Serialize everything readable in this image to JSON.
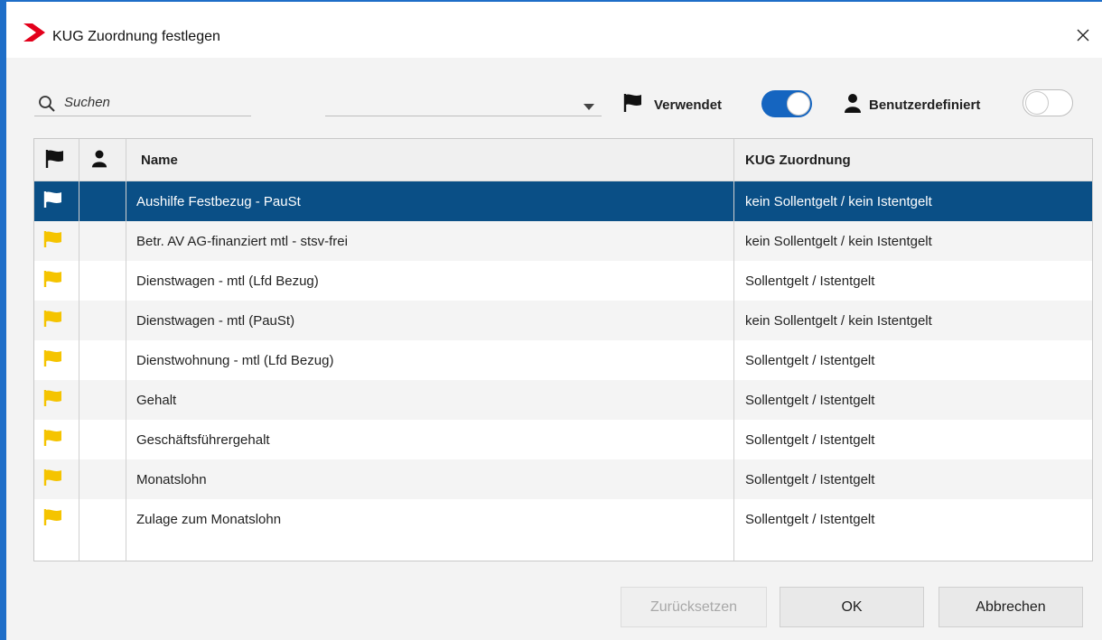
{
  "window": {
    "title": "KUG Zuordnung festlegen",
    "accent_color": "#1e6ec8",
    "logo_color": "#e3001b"
  },
  "toolbar": {
    "search": {
      "placeholder": "Suchen",
      "value": ""
    },
    "filter_combo": {
      "value": ""
    },
    "used_filter": {
      "label": "Verwendet",
      "on": true
    },
    "custom_filter": {
      "label": "Benutzerdefiniert",
      "on": false
    }
  },
  "grid": {
    "columns": [
      {
        "label": "",
        "icon": "flag-icon"
      },
      {
        "label": "",
        "icon": "user-icon"
      },
      {
        "label": "Name"
      },
      {
        "label": "KUG Zuordnung"
      }
    ],
    "rows": [
      {
        "flag": "white",
        "name": "Aushilfe Festbezug - PauSt",
        "kug": "kein Sollentgelt / kein Istentgelt",
        "selected": true
      },
      {
        "flag": "yellow",
        "name": "Betr. AV  AG-finanziert mtl - stsv-frei",
        "kug": "kein Sollentgelt / kein Istentgelt",
        "selected": false
      },
      {
        "flag": "yellow",
        "name": "Dienstwagen - mtl (Lfd Bezug)",
        "kug": "Sollentgelt / Istentgelt",
        "selected": false
      },
      {
        "flag": "yellow",
        "name": "Dienstwagen - mtl (PauSt)",
        "kug": "kein Sollentgelt / kein Istentgelt",
        "selected": false
      },
      {
        "flag": "yellow",
        "name": "Dienstwohnung - mtl (Lfd Bezug)",
        "kug": "Sollentgelt / Istentgelt",
        "selected": false
      },
      {
        "flag": "yellow",
        "name": "Gehalt",
        "kug": "Sollentgelt / Istentgelt",
        "selected": false
      },
      {
        "flag": "yellow",
        "name": "Geschäftsführergehalt",
        "kug": "Sollentgelt / Istentgelt",
        "selected": false
      },
      {
        "flag": "yellow",
        "name": "Monatslohn",
        "kug": "Sollentgelt / Istentgelt",
        "selected": false
      },
      {
        "flag": "yellow",
        "name": "Zulage zum Monatslohn",
        "kug": "Sollentgelt / Istentgelt",
        "selected": false
      }
    ],
    "selected_color": "#0a4f86",
    "flag_yellow_color": "#f5c400"
  },
  "buttons": {
    "reset": {
      "label": "Zurücksetzen",
      "disabled": true
    },
    "ok": {
      "label": "OK"
    },
    "cancel": {
      "label": "Abbrechen"
    }
  }
}
